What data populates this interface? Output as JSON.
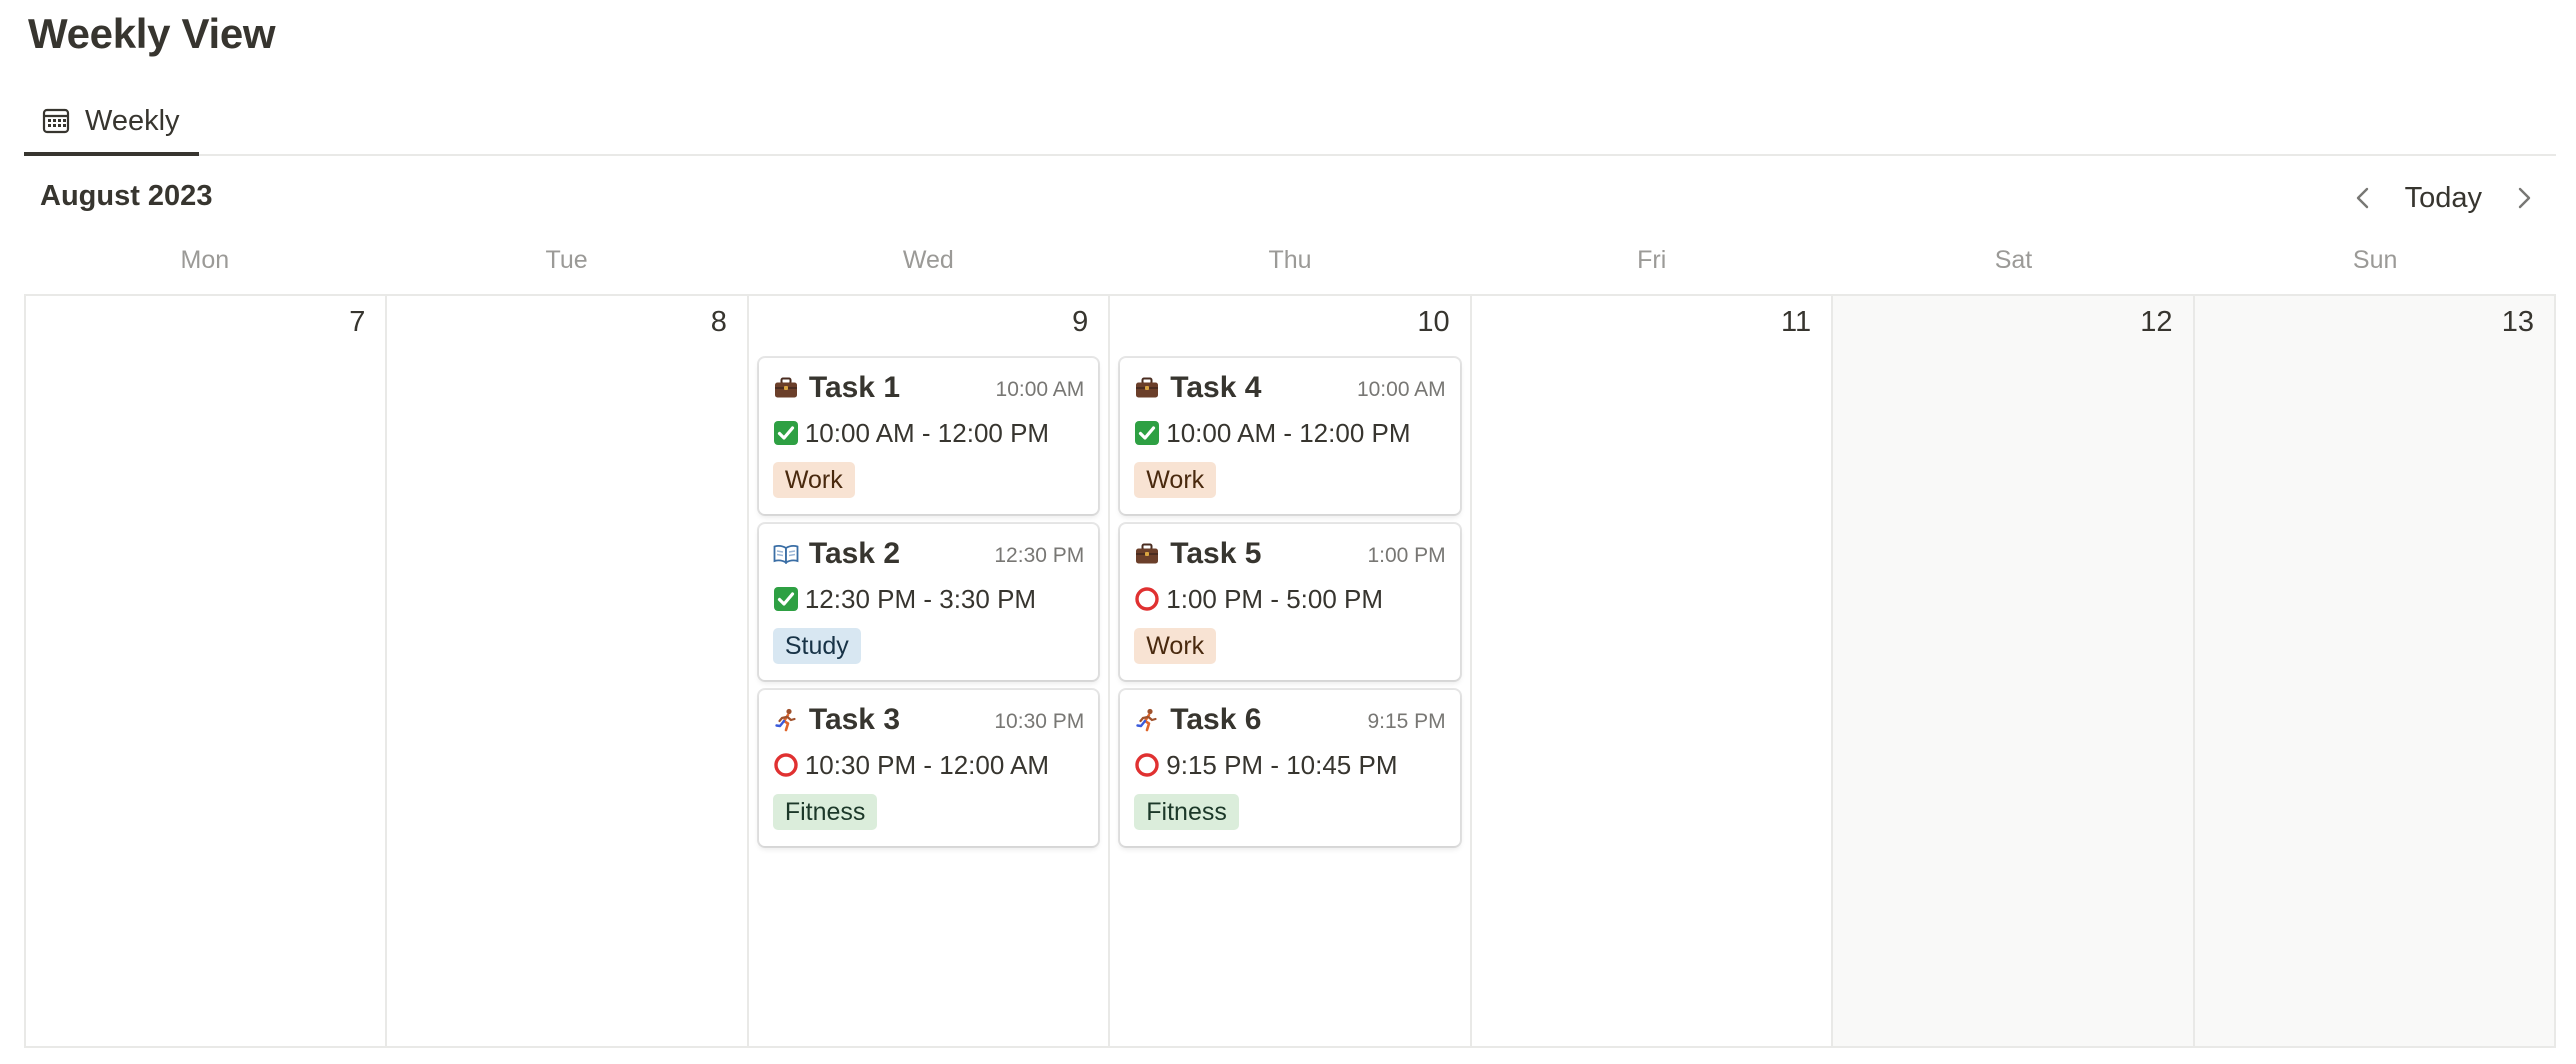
{
  "page": {
    "title": "Weekly View"
  },
  "tabs": [
    {
      "label": "Weekly",
      "icon": "calendar-icon"
    }
  ],
  "toolbar": {
    "month": "August 2023",
    "today_label": "Today"
  },
  "weekdays": [
    "Mon",
    "Tue",
    "Wed",
    "Thu",
    "Fri",
    "Sat",
    "Sun"
  ],
  "days": [
    "7",
    "8",
    "9",
    "10",
    "11",
    "12",
    "13"
  ],
  "tag_colors": {
    "Work": {
      "bg": "#f8e3d3",
      "fg": "#49290e"
    },
    "Study": {
      "bg": "#d8e7f2",
      "fg": "#183347"
    },
    "Fitness": {
      "bg": "#dbeddb",
      "fg": "#1c3829"
    }
  },
  "events": {
    "wed": [
      {
        "title": "Task 1",
        "time": "10:00 AM",
        "range": "10:00 AM - 12:00 PM",
        "status": "done",
        "tag": "Work",
        "icon": "briefcase-icon"
      },
      {
        "title": "Task 2",
        "time": "12:30 PM",
        "range": "12:30 PM - 3:30 PM",
        "status": "done",
        "tag": "Study",
        "icon": "book-icon"
      },
      {
        "title": "Task 3",
        "time": "10:30 PM",
        "range": "10:30 PM - 12:00 AM",
        "status": "todo",
        "tag": "Fitness",
        "icon": "runner-icon"
      }
    ],
    "thu": [
      {
        "title": "Task 4",
        "time": "10:00 AM",
        "range": "10:00 AM - 12:00 PM",
        "status": "done",
        "tag": "Work",
        "icon": "briefcase-icon"
      },
      {
        "title": "Task 5",
        "time": "1:00 PM",
        "range": "1:00 PM - 5:00 PM",
        "status": "todo",
        "tag": "Work",
        "icon": "briefcase-icon"
      },
      {
        "title": "Task 6",
        "time": "9:15 PM",
        "range": "9:15 PM - 10:45 PM",
        "status": "todo",
        "tag": "Fitness",
        "icon": "runner-icon"
      }
    ]
  }
}
